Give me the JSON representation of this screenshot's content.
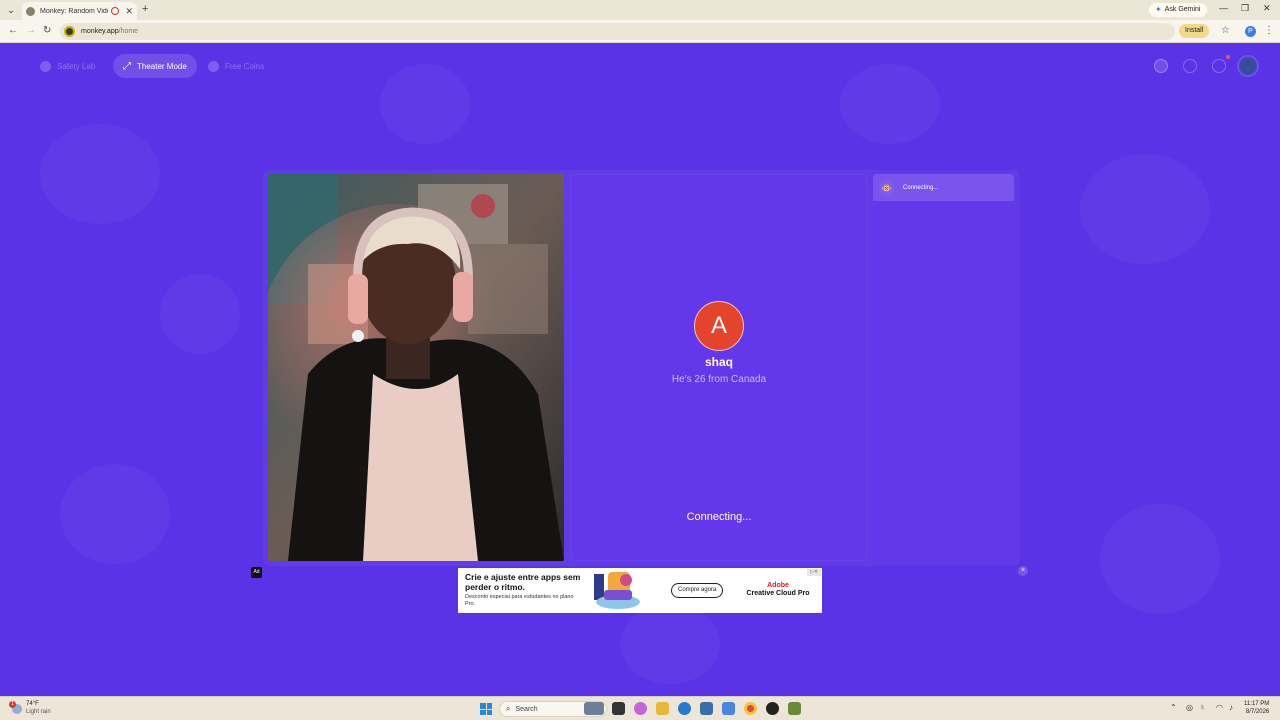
{
  "browser": {
    "tab_title": "Monkey: Random Video Ch",
    "new_tab": "+",
    "ask_gemini": "Ask Gemini",
    "url_host": "monkey.app",
    "url_path": "/home",
    "install": "Install",
    "profile_initial": "P"
  },
  "nav": {
    "safety_lab": "Safety Lab",
    "theater_mode": "Theater Mode",
    "free_coins": "Free Coins"
  },
  "match": {
    "avatar_letter": "A",
    "name": "shaq",
    "info": "He's 26 from Canada",
    "status": "Connecting..."
  },
  "sidebar": {
    "chat_status": "Connecting..."
  },
  "ad": {
    "badge": "Ad",
    "headline": "Crie e ajuste entre apps sem perder o ritmo.",
    "subtext": "Desconto especial para estudantes no plano Pro.",
    "cta": "Compre agora",
    "brand_a": "Adobe",
    "brand_b": "Creative Cloud Pro",
    "close": "×"
  },
  "taskbar": {
    "weather_badge": "1",
    "weather_temp": "74°F",
    "weather_desc": "Light rain",
    "search_placeholder": "Search",
    "time": "11:17 PM",
    "date": "8/7/2026"
  },
  "colors": {
    "app_bg": "#5b33e6",
    "panel": "#6338ea",
    "avatar": "#e4442c"
  }
}
